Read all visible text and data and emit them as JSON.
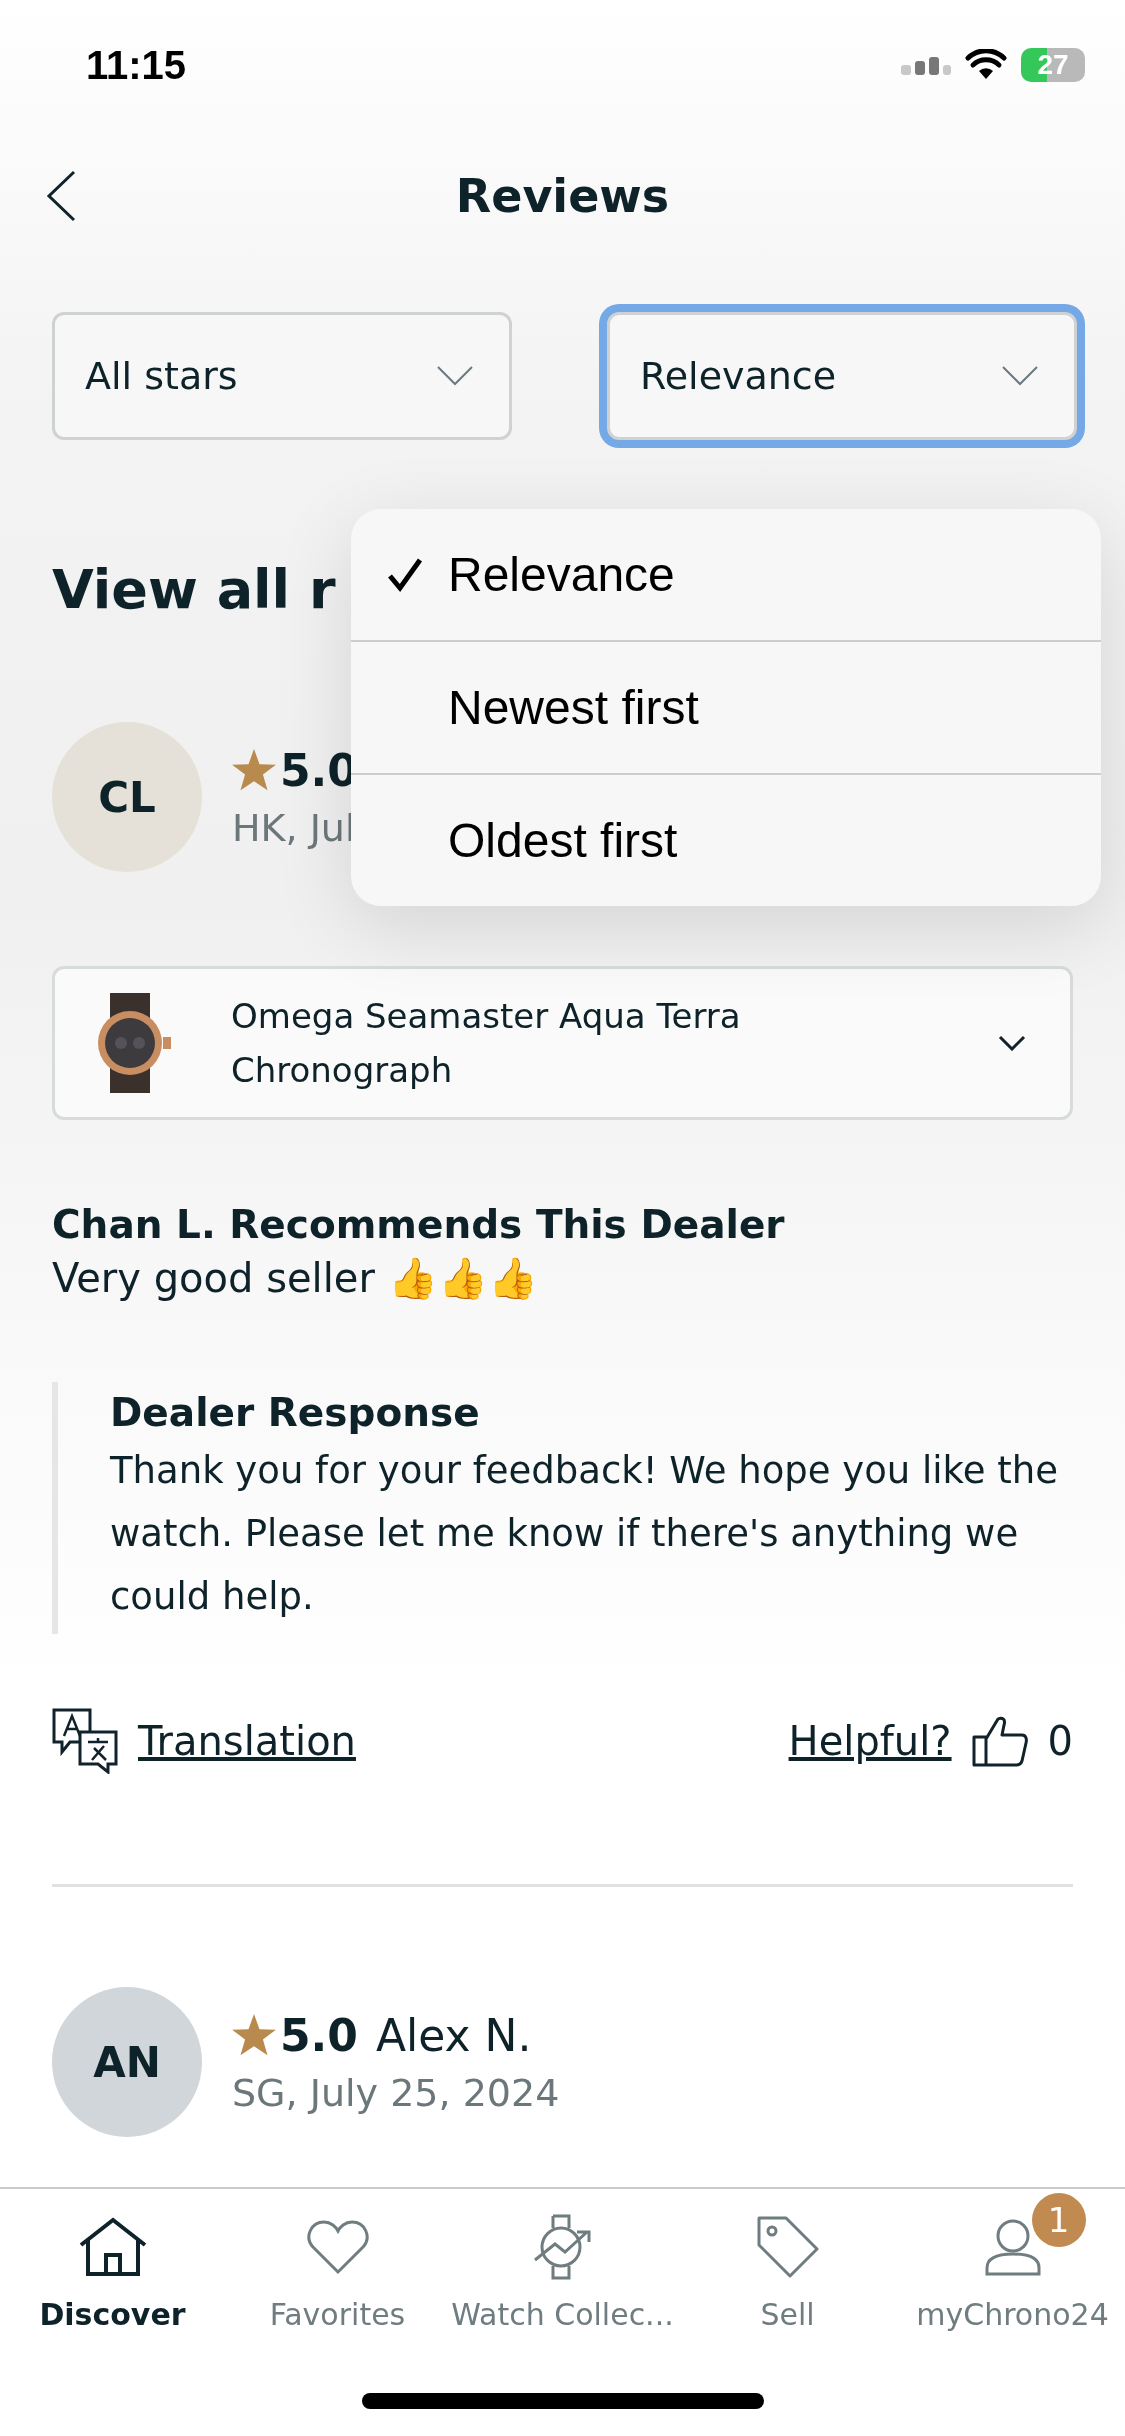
{
  "status_bar": {
    "time": "11:15",
    "battery": "27"
  },
  "header": {
    "title": "Reviews"
  },
  "filters": [
    {
      "label": "All stars",
      "focused": false
    },
    {
      "label": "Relevance",
      "focused": true
    }
  ],
  "sort_menu": [
    {
      "label": "Relevance",
      "selected": true
    },
    {
      "label": "Newest first",
      "selected": false
    },
    {
      "label": "Oldest first",
      "selected": false
    }
  ],
  "section_title": "View all r",
  "reviews": [
    {
      "initials": "CL",
      "color": "#e6e1d8",
      "rating": "5.0",
      "meta": "HK, Jul",
      "product": "Omega Seamaster Aqua Terra Chronograph",
      "headline": "Chan L. Recommends This Dealer",
      "text": "Very good seller 👍👍👍",
      "response_title": "Dealer Response",
      "response": "Thank you for your feedback! We hope you like the watch. Please let me know if there's anything we could help.",
      "translation": "Translation",
      "helpful": "Helpful?",
      "helpful_count": "0"
    },
    {
      "initials": "AN",
      "color": "#d1d6db",
      "rating": "5.0",
      "name": "Alex N.",
      "meta": "SG, July 25, 2024"
    }
  ],
  "tabs": [
    {
      "kind": "home",
      "label": "Discover",
      "selected": true
    },
    {
      "kind": "heart",
      "label": "Favorites",
      "selected": false
    },
    {
      "kind": "watch",
      "label": "Watch Collec...",
      "selected": false
    },
    {
      "kind": "tag",
      "label": "Sell",
      "selected": false
    },
    {
      "kind": "person",
      "label": "myChrono24",
      "selected": false,
      "badge": "1"
    }
  ]
}
